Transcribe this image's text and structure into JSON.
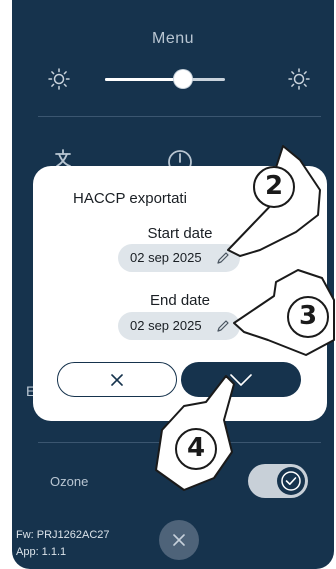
{
  "panel": {
    "title": "Menu",
    "icons": {
      "brightness_low": "sun-low-icon",
      "brightness_high": "sun-high-icon",
      "language": "language-icon",
      "power": "power-icon"
    },
    "brightness_level": 0.65,
    "side_letter": "E",
    "ozone": {
      "label": "Ozone",
      "enabled": true
    },
    "firmware": "Fw: PRJ1262AC27",
    "app_version": "App: 1.1.1"
  },
  "dialog": {
    "title": "HACCP exportati",
    "start": {
      "label": "Start date",
      "value": "02 sep 2025",
      "icon": "pencil-icon"
    },
    "end": {
      "label": "End date",
      "value": "02 sep 2025",
      "icon": "pencil-icon"
    },
    "cancel_icon": "close-x-icon",
    "confirm_icon": "chevron-down-icon"
  },
  "steps": [
    "2",
    "3",
    "4"
  ],
  "colors": {
    "panel": "#16334d",
    "dialog": "#ffffff",
    "pill": "#dfe5ea",
    "muted_text": "#b9c6d2"
  }
}
